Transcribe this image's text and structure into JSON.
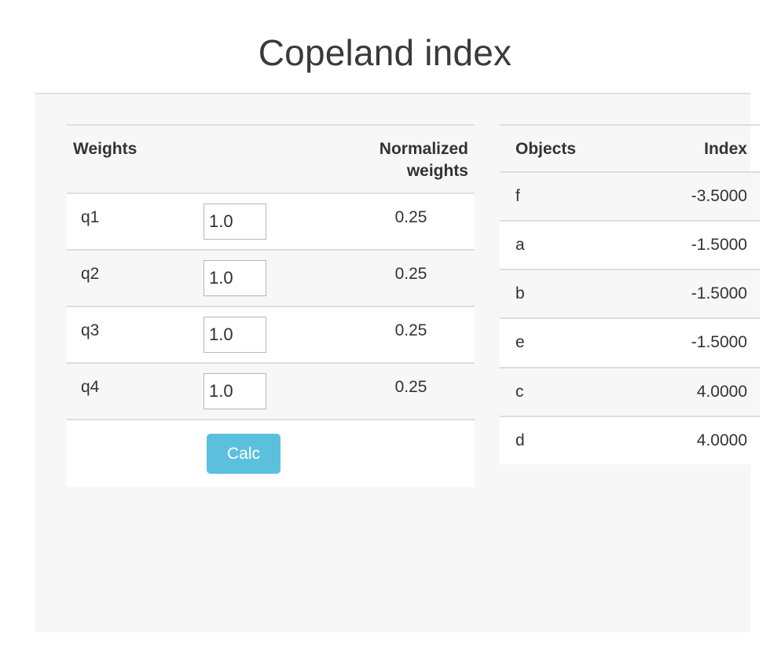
{
  "page": {
    "title": "Copeland index"
  },
  "weights_table": {
    "headers": {
      "label": "Weights",
      "input": "",
      "normalized": "Normalized weights"
    },
    "rows": [
      {
        "label": "q1",
        "value": "1.0",
        "normalized": "0.25"
      },
      {
        "label": "q2",
        "value": "1.0",
        "normalized": "0.25"
      },
      {
        "label": "q3",
        "value": "1.0",
        "normalized": "0.25"
      },
      {
        "label": "q4",
        "value": "1.0",
        "normalized": "0.25"
      }
    ],
    "calc_button_label": "Calc"
  },
  "index_table": {
    "headers": {
      "objects": "Objects",
      "index": "Index"
    },
    "rows": [
      {
        "object": "f",
        "index": "-3.5000"
      },
      {
        "object": "a",
        "index": "-1.5000"
      },
      {
        "object": "b",
        "index": "-1.5000"
      },
      {
        "object": "e",
        "index": "-1.5000"
      },
      {
        "object": "c",
        "index": "4.0000"
      },
      {
        "object": "d",
        "index": "4.0000"
      }
    ]
  },
  "colors": {
    "accent": "#5bc0de",
    "panel_background": "#f7f7f7",
    "page_background": "#ffffff",
    "text": "#333333",
    "border": "#dddddd"
  }
}
